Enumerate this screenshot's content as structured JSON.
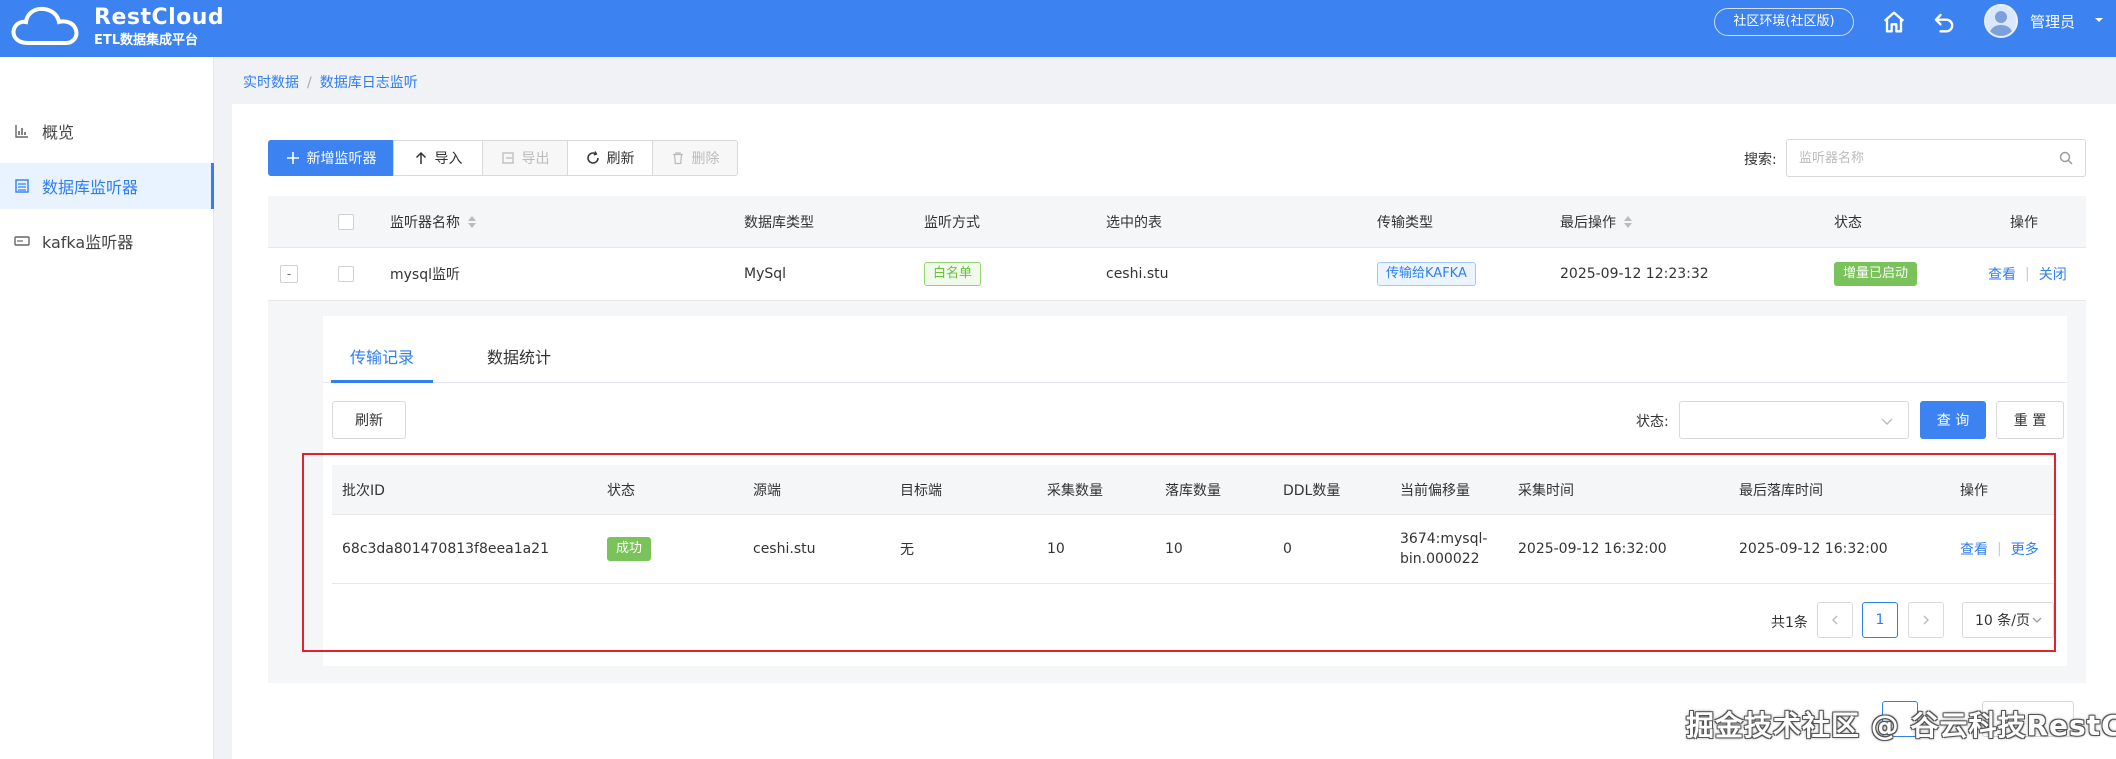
{
  "app": {
    "brand": "RestCloud",
    "subtitle": "ETL数据集成平台",
    "environment": "社区环境(社区版)",
    "user_name": "管理员"
  },
  "sidebar": {
    "items": [
      {
        "label": "概览",
        "icon": "chart-icon",
        "active": false
      },
      {
        "label": "数据库监听器",
        "icon": "list-icon",
        "active": true
      },
      {
        "label": "kafka监听器",
        "icon": "server-icon",
        "active": false
      }
    ]
  },
  "breadcrumb": {
    "items": [
      "实时数据",
      "数据库日志监听"
    ],
    "separator": "/"
  },
  "toolbar": {
    "add_label": "新增监听器",
    "import_label": "导入",
    "export_label": "导出",
    "refresh_label": "刷新",
    "delete_label": "删除",
    "search_label": "搜索:",
    "search_placeholder": "监听器名称"
  },
  "listener_table": {
    "columns": [
      "监听器名称",
      "数据库类型",
      "监听方式",
      "选中的表",
      "传输类型",
      "最后操作",
      "状态",
      "操作"
    ],
    "rows": [
      {
        "expand": "-",
        "name": "mysql监听",
        "db_type": "MySql",
        "mode": "白名单",
        "tables": "ceshi.stu",
        "transfer": "传输给KAFKA",
        "last_op": "2025-09-12 12:23:32",
        "status": "增量已启动",
        "actions": [
          "查看",
          "关闭"
        ]
      }
    ]
  },
  "detail": {
    "tabs": [
      "传输记录",
      "数据统计"
    ],
    "active_tab": "传输记录",
    "refresh_label": "刷新",
    "status_label": "状态:",
    "status_value": "",
    "query_label": "查 询",
    "reset_label": "重 置"
  },
  "batch_table": {
    "columns": [
      "批次ID",
      "状态",
      "源端",
      "目标端",
      "采集数量",
      "落库数量",
      "DDL数量",
      "当前偏移量",
      "采集时间",
      "最后落库时间",
      "操作"
    ],
    "rows": [
      {
        "batch_id": "68c3da801470813f8eea1a21",
        "status": "成功",
        "source": "ceshi.stu",
        "target": "无",
        "collected": "10",
        "stored": "10",
        "ddl": "0",
        "offset": "3674:mysql-bin.000022",
        "collect_time": "2025-09-12 16:32:00",
        "last_store_time": "2025-09-12 16:32:00",
        "actions": [
          "查看",
          "更多"
        ]
      }
    ]
  },
  "pagination": {
    "total_text": "共1条",
    "current_page": "1",
    "page_size": "10 条/页"
  },
  "watermark": "掘金技术社区 @ 谷云科技RestCloud",
  "colors": {
    "header_bg": "#3c82f0",
    "primary": "#2f7ef2",
    "success": "#7ac25a",
    "highlight_box": "#e0232d"
  }
}
